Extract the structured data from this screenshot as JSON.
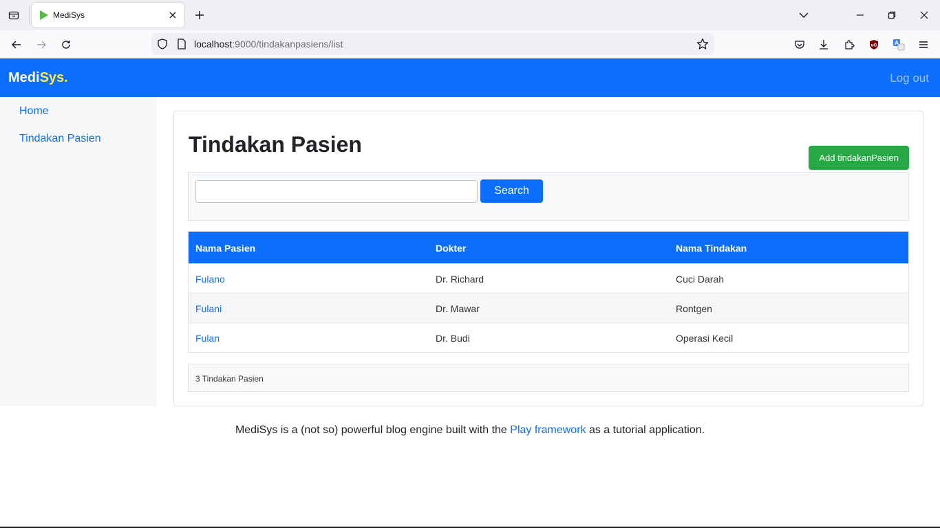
{
  "browser": {
    "tab_title": "MediSys",
    "url_host": "localhost",
    "url_rest": ":9000/tindakanpasiens/list"
  },
  "app": {
    "brand_medi": "Medi",
    "brand_sys": "Sys.",
    "logout_label": "Log out",
    "colors": {
      "primary": "#0d6efd",
      "success": "#28a745",
      "brand_accent": "#ffeb3b"
    }
  },
  "sidebar": {
    "items": [
      {
        "label": "Home"
      },
      {
        "label": "Tindakan Pasien"
      }
    ]
  },
  "main": {
    "title": "Tindakan Pasien",
    "add_button": "Add tindakanPasien",
    "search": {
      "value": "",
      "placeholder": "",
      "button": "Search"
    },
    "table": {
      "headers": [
        "Nama Pasien",
        "Dokter",
        "Nama Tindakan"
      ],
      "rows": [
        {
          "pasien": "Fulano",
          "dokter": "Dr. Richard",
          "tindakan": "Cuci Darah"
        },
        {
          "pasien": "Fulani",
          "dokter": "Dr. Mawar",
          "tindakan": "Rontgen"
        },
        {
          "pasien": "Fulan",
          "dokter": "Dr. Budi",
          "tindakan": "Operasi Kecil"
        }
      ]
    },
    "count_text": "3 Tindakan Pasien"
  },
  "footer": {
    "before": "MediSys is a (not so) powerful blog engine built with the ",
    "link": "Play framework",
    "after": " as a tutorial application."
  }
}
